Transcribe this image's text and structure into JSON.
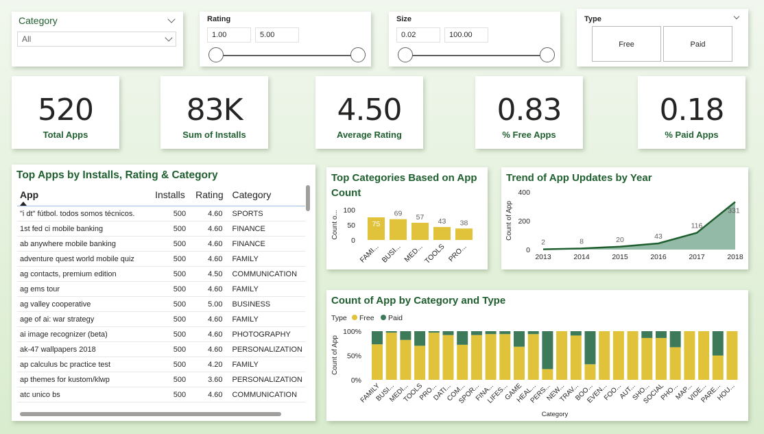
{
  "slicers": {
    "category": {
      "title": "Category",
      "value": "All"
    },
    "rating": {
      "title": "Rating",
      "min": "1.00",
      "max": "5.00"
    },
    "size": {
      "title": "Size",
      "min": "0.02",
      "max": "100.00"
    },
    "type": {
      "title": "Type",
      "options": [
        "Free",
        "Paid"
      ]
    }
  },
  "kpis": [
    {
      "value": "520",
      "label": "Total Apps"
    },
    {
      "value": "83K",
      "label": "Sum of Installs"
    },
    {
      "value": "4.50",
      "label": "Average Rating"
    },
    {
      "value": "0.83",
      "label": "% Free Apps"
    },
    {
      "value": "0.18",
      "label": "% Paid Apps"
    }
  ],
  "top_apps": {
    "title": "Top Apps by Installs, Rating & Category",
    "columns": [
      "App",
      "Installs",
      "Rating",
      "Category"
    ],
    "rows": [
      [
        "\"i dt\" fútbol. todos somos técnicos.",
        "500",
        "4.60",
        "SPORTS"
      ],
      [
        "1st fed ci mobile banking",
        "500",
        "4.60",
        "FINANCE"
      ],
      [
        "ab anywhere mobile banking",
        "500",
        "4.60",
        "FINANCE"
      ],
      [
        "adventure quest world mobile quiz",
        "500",
        "4.60",
        "FAMILY"
      ],
      [
        "ag contacts, premium edition",
        "500",
        "4.50",
        "COMMUNICATION"
      ],
      [
        "ag ems tour",
        "500",
        "4.60",
        "FAMILY"
      ],
      [
        "ag valley cooperative",
        "500",
        "5.00",
        "BUSINESS"
      ],
      [
        "age of ai: war strategy",
        "500",
        "4.60",
        "FAMILY"
      ],
      [
        "ai image recognizer (beta)",
        "500",
        "4.60",
        "PHOTOGRAPHY"
      ],
      [
        "ak-47 wallpapers 2018",
        "500",
        "4.60",
        "PERSONALIZATION"
      ],
      [
        "ap calculus bc practice test",
        "500",
        "4.20",
        "FAMILY"
      ],
      [
        "ap themes for kustom/klwp",
        "500",
        "3.60",
        "PERSONALIZATION"
      ],
      [
        "atc unico bs",
        "500",
        "4.60",
        "COMMUNICATION"
      ]
    ]
  },
  "chart_data": [
    {
      "type": "bar",
      "title": "Top Categories Based on App Count",
      "ylabel": "Count o...",
      "categories": [
        "FAMI...",
        "BUSI...",
        "MED...",
        "TOOLS",
        "PRO..."
      ],
      "values": [
        75,
        69,
        57,
        43,
        38
      ],
      "ylim": [
        0,
        100
      ],
      "yticks": [
        "0",
        "50",
        "100"
      ],
      "color": "#e1c33b"
    },
    {
      "type": "area",
      "title": "Trend of App Updates by Year",
      "ylabel": "Count of App",
      "x": [
        "2013",
        "2014",
        "2015",
        "2016",
        "2017",
        "2018"
      ],
      "values": [
        2,
        8,
        20,
        43,
        116,
        331
      ],
      "ylim": [
        0,
        400
      ],
      "yticks": [
        "0",
        "200",
        "400"
      ],
      "color": "#1f5e2e",
      "fill": "#7fae96"
    },
    {
      "type": "bar",
      "stacked": "100%",
      "title": "Count of App by Category and Type",
      "legend_title": "Type",
      "xlabel": "Category",
      "ylabel": "Count of App",
      "yticks": [
        "0%",
        "50%",
        "100%"
      ],
      "categories": [
        "FAMILY",
        "BUSI...",
        "MEDI...",
        "TOOLS",
        "PRO...",
        "DATI...",
        "COM...",
        "SPOR...",
        "FINA...",
        "LIFES...",
        "GAME",
        "HEAL...",
        "PERS...",
        "NEW...",
        "TRAV...",
        "BOO...",
        "EVEN...",
        "FOO...",
        "AUT...",
        "SHO...",
        "SOCIAL",
        "PHO...",
        "MAP...",
        "VIDE...",
        "PARE...",
        "HOU..."
      ],
      "series": [
        {
          "name": "Free",
          "color": "#e1c33b",
          "values": [
            73,
            97,
            82,
            70,
            97,
            92,
            72,
            92,
            94,
            94,
            68,
            94,
            22,
            100,
            91,
            32,
            100,
            100,
            100,
            86,
            86,
            67,
            100,
            100,
            50,
            100
          ]
        },
        {
          "name": "Paid",
          "color": "#3d7a5a",
          "values": [
            27,
            3,
            18,
            30,
            3,
            8,
            28,
            8,
            6,
            6,
            32,
            6,
            78,
            0,
            9,
            68,
            0,
            0,
            0,
            14,
            14,
            33,
            0,
            0,
            50,
            0
          ]
        }
      ]
    }
  ]
}
